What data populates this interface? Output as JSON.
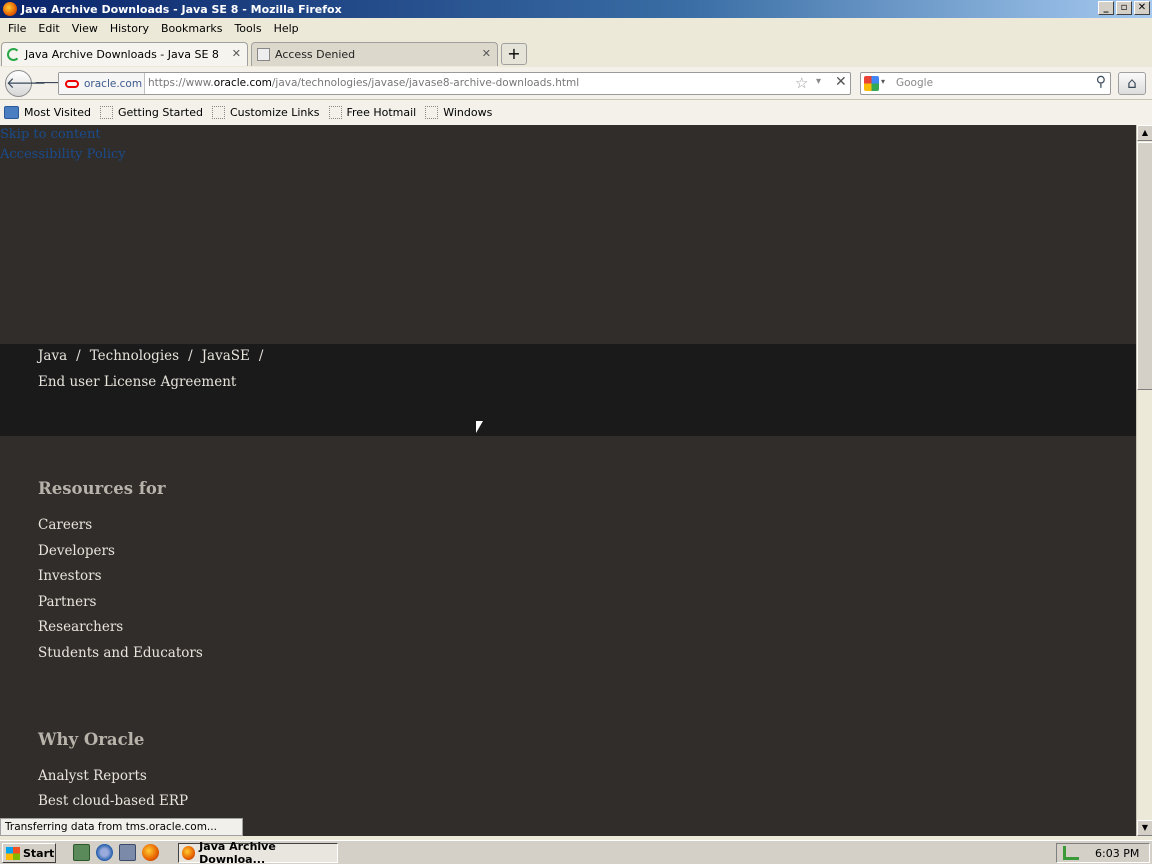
{
  "window": {
    "title": "Java Archive Downloads - Java SE 8 - Mozilla Firefox",
    "controls": [
      "_",
      "▫",
      "✕"
    ]
  },
  "menu": [
    "File",
    "Edit",
    "View",
    "History",
    "Bookmarks",
    "Tools",
    "Help"
  ],
  "tabs": [
    {
      "label": "Java Archive Downloads - Java SE 8",
      "close": "✕"
    },
    {
      "label": "Access Denied",
      "close": "✕"
    }
  ],
  "newtab": "+",
  "nav": {
    "back": "🡐",
    "forward": "🡒",
    "site_id": "oracle.com",
    "url_pre": "https://www.",
    "url_domain": "oracle.com",
    "url_post": "/java/technologies/javase/javase8-archive-downloads.html",
    "star": "☆",
    "dropdown": "▾",
    "stop": "✕",
    "search_placeholder": "Google",
    "search_drop": "▾",
    "search_icon": "⚲",
    "home": "⌂"
  },
  "bookmarks": [
    "Most Visited",
    "Getting Started",
    "Customize Links",
    "Free Hotmail",
    "Windows"
  ],
  "page": {
    "skip_link": "Skip to content",
    "accessibility_link": "Accessibility Policy",
    "breadcrumb": [
      "Java",
      "Technologies",
      "JavaSE"
    ],
    "breadcrumb_sep": "/",
    "page_subtitle": "End user License Agreement",
    "resources_heading": "Resources for",
    "resources_links": [
      "Careers",
      "Developers",
      "Investors",
      "Partners",
      "Researchers",
      "Students and Educators"
    ],
    "why_heading": "Why Oracle",
    "why_links": [
      "Analyst Reports",
      "Best cloud-based ERP"
    ]
  },
  "scrollbar": {
    "up": "▲",
    "down": "▼"
  },
  "status": "Transferring data from tms.oracle.com...",
  "taskbar": {
    "start": "Start",
    "active_task": "Java Archive Downloa...",
    "clock": "6:03 PM"
  },
  "colors": {
    "page_bg": "#312d2a",
    "breadcrumb_band": "#1a1a1a",
    "link_text": "#e8e4dc",
    "heading_text": "#b8b3aa"
  }
}
